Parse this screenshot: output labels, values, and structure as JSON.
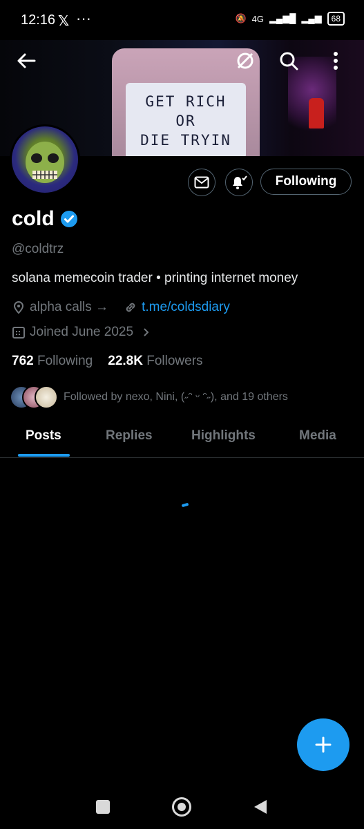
{
  "status_bar": {
    "time": "12:16",
    "network": "4G",
    "battery": "68"
  },
  "banner": {
    "sign_line1": "GET RICH",
    "sign_line2": "OR",
    "sign_line3": "DIE TRYIN"
  },
  "profile": {
    "name": "cold",
    "handle": "@coldtrz",
    "bio": "solana memecoin trader • printing internet money",
    "location": "alpha calls →",
    "link": "t.me/coldsdiary",
    "joined": "Joined June 2025",
    "following_count": "762",
    "following_label": "Following",
    "followers_count": "22.8K",
    "followers_label": "Followers",
    "followed_by": "Followed by nexo, Nini, (˶ᵔ ᵕ ᵔ˶), and 19 others"
  },
  "actions": {
    "follow_state": "Following"
  },
  "tabs": [
    {
      "label": "Posts",
      "active": true
    },
    {
      "label": "Replies",
      "active": false
    },
    {
      "label": "Highlights",
      "active": false
    },
    {
      "label": "Media",
      "active": false
    }
  ],
  "icons": {
    "back": "back-arrow-icon",
    "grok": "grok-icon",
    "search": "search-icon",
    "more": "more-vertical-icon",
    "message": "mail-icon",
    "notify": "bell-subscribed-icon",
    "verified": "verified-badge-icon",
    "location": "location-pin-icon",
    "link": "link-icon",
    "calendar": "calendar-icon",
    "compose": "plus-icon"
  },
  "colors": {
    "accent": "#1d9bf0",
    "background": "#000000",
    "muted": "#71767b"
  }
}
